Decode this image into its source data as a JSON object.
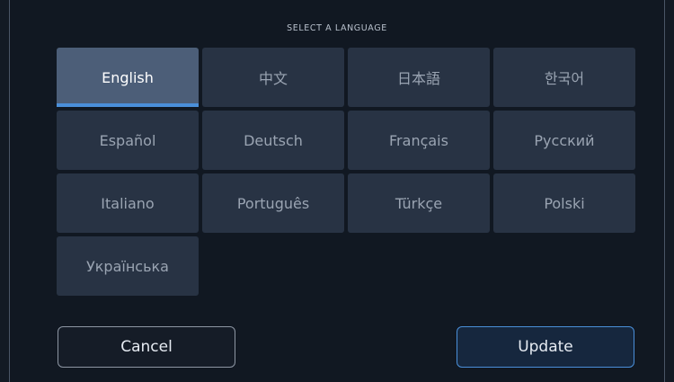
{
  "dialog": {
    "title": "SELECT A LANGUAGE"
  },
  "languages": [
    {
      "label": "English",
      "selected": true
    },
    {
      "label": "中文",
      "selected": false
    },
    {
      "label": "日本語",
      "selected": false
    },
    {
      "label": "한국어",
      "selected": false
    },
    {
      "label": "Español",
      "selected": false
    },
    {
      "label": "Deutsch",
      "selected": false
    },
    {
      "label": "Français",
      "selected": false
    },
    {
      "label": "Русский",
      "selected": false
    },
    {
      "label": "Italiano",
      "selected": false
    },
    {
      "label": "Português",
      "selected": false
    },
    {
      "label": "Türkçe",
      "selected": false
    },
    {
      "label": "Polski",
      "selected": false
    },
    {
      "label": "Українська",
      "selected": false
    }
  ],
  "buttons": {
    "cancel": "Cancel",
    "update": "Update"
  },
  "colors": {
    "accent": "#4a8fd9",
    "selected_tile": "#4c5e78",
    "tile": "#283344",
    "background": "#111822"
  }
}
